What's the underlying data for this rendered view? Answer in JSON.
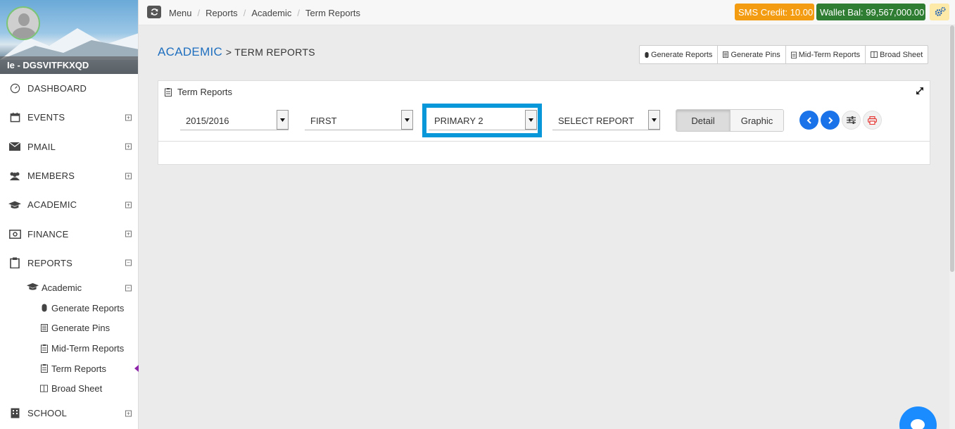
{
  "profile": {
    "name": "Ie - DGSVITFKXQD"
  },
  "sidebar": {
    "items": [
      {
        "label": "DASHBOARD",
        "icon": "dashboard-icon"
      },
      {
        "label": "EVENTS",
        "icon": "calendar-icon",
        "toggle": "⊞"
      },
      {
        "label": "PMAIL",
        "icon": "envelope-icon",
        "toggle": "⊞"
      },
      {
        "label": "MEMBERS",
        "icon": "users-icon",
        "toggle": "⊞"
      },
      {
        "label": "ACADEMIC",
        "icon": "graduation-cap-icon",
        "toggle": "⊞"
      },
      {
        "label": "FINANCE",
        "icon": "money-icon",
        "toggle": "⊞"
      },
      {
        "label": "REPORTS",
        "icon": "clipboard-icon",
        "toggle": "⊟"
      }
    ],
    "reports_sub": {
      "label": "Academic",
      "toggle": "⊟",
      "children": [
        {
          "label": "Generate Reports",
          "icon": "mouse-icon"
        },
        {
          "label": "Generate Pins",
          "icon": "list-icon"
        },
        {
          "label": "Mid-Term Reports",
          "icon": "report-icon"
        },
        {
          "label": "Term Reports",
          "icon": "report-icon"
        },
        {
          "label": "Broad Sheet",
          "icon": "columns-icon"
        }
      ]
    },
    "school": {
      "label": "SCHOOL",
      "toggle": "⊞"
    }
  },
  "topbar": {
    "breadcrumbs": [
      "Menu",
      "Reports",
      "Academic",
      "Term Reports"
    ],
    "sms_credit": "SMS Credit: 10.00",
    "wallet": "Wallet Bal: 99,567,000.00"
  },
  "page": {
    "title_main": "ACADEMIC",
    "title_sub": "> TERM REPORTS",
    "actions": [
      "Generate Reports",
      "Generate Pins",
      "Mid-Term Reports",
      "Broad Sheet"
    ]
  },
  "panel": {
    "title": "Term Reports",
    "filters": {
      "session": "2015/2016",
      "term": "FIRST",
      "class": "PRIMARY 2",
      "report": "SELECT REPORT"
    },
    "view_toggle": {
      "detail": "Detail",
      "graphic": "Graphic",
      "selected": "Detail"
    }
  },
  "colors": {
    "accent": "#1f6fbf",
    "sms": "#f39c12",
    "wallet": "#2e7d32",
    "highlight": "#0897d8"
  }
}
